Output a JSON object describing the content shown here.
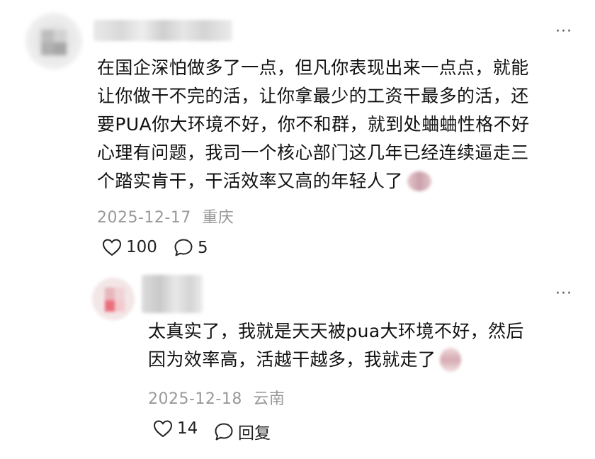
{
  "main_comment": {
    "lines": [
      "在国企深怕做多了一点，但凡你表现出来一点点，就能",
      "让你做干不完的活，让你拿最少的工资干最多的活，还",
      "要PUA你大环境不好，你不和群，就到处蛐蛐性格不好",
      "心理有问题，我司一个核心部门这几年已经连续逼走三",
      "个踏实肯干，干活效率又高的年轻人了"
    ],
    "date": "2025-12-17",
    "location": "重庆",
    "likes": "100",
    "replies": "5",
    "more": "···"
  },
  "reply_comment": {
    "lines": [
      "太真实了，我就是天天被pua大环境不好，然后",
      "因为效率高，活越干越多，我就走了"
    ],
    "date": "2025-12-18",
    "location": "云南",
    "likes": "14",
    "reply_label": "回复",
    "more": "···"
  },
  "colors": {
    "text": "#111111",
    "meta": "#999999",
    "icon": "#222222"
  },
  "icons": {
    "like": "heart-outline-icon",
    "comment": "speech-bubble-icon",
    "more": "ellipsis-icon"
  }
}
